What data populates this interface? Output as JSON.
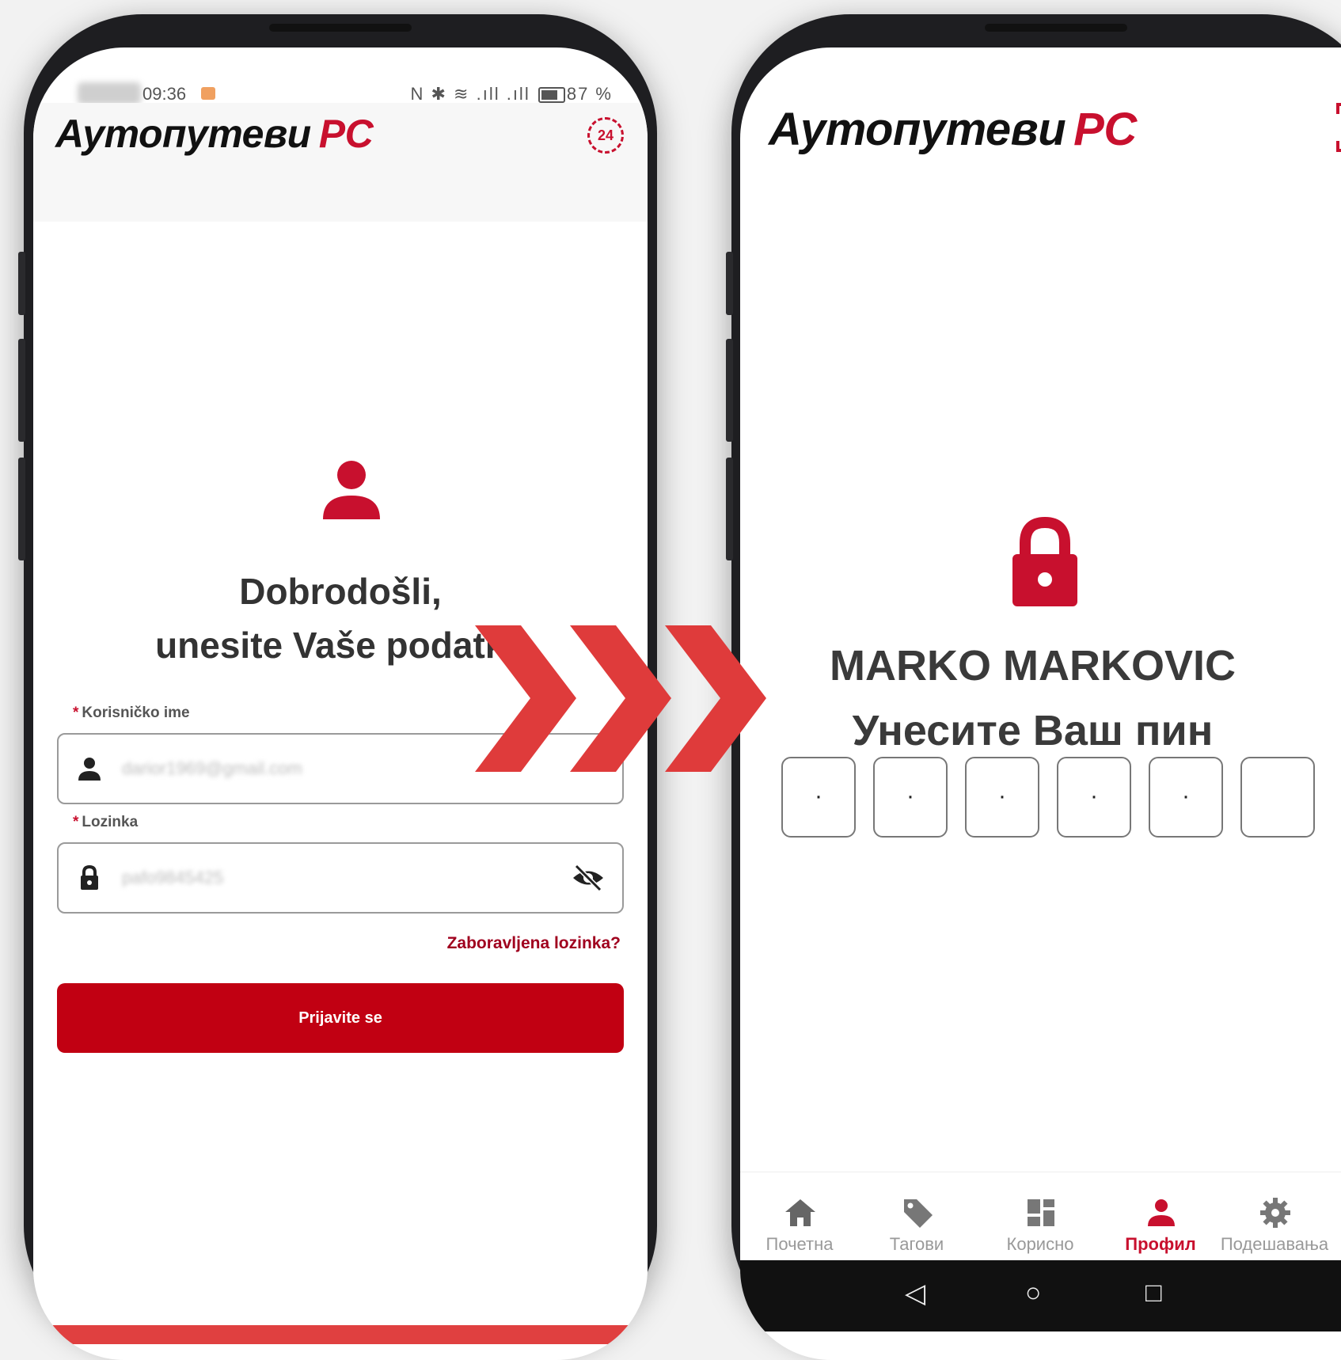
{
  "left_screen": {
    "status": {
      "time": "09:36",
      "battery": "87 %",
      "icons": "N ✱ ≋ .ıll .ıll"
    },
    "app_title": "Аутопутеви",
    "app_title_suffix": "РС",
    "badge_24": "24",
    "welcome_line1": "Dobrodošli,",
    "welcome_line2": "unesite Vaše podatke",
    "username": {
      "label": "Korisničko ime",
      "required_mark": "*",
      "value": "darior1969@gmail.com"
    },
    "password": {
      "label": "Lozinka",
      "required_mark": "*",
      "value": "pafo9845425"
    },
    "forgot_password": "Zaboravljena lozinka?",
    "login_button": "Prijavite se"
  },
  "right_screen": {
    "app_title": "Аутопутеви",
    "app_title_suffix": "РС",
    "user_name": "MARKO MARKOVIC",
    "pin_prompt": "Унесите Ваш пин",
    "pin_digits": [
      "·",
      "·",
      "·",
      "·",
      "·",
      ""
    ],
    "bottom_nav": [
      {
        "label": "Почетна",
        "icon": "home-icon",
        "active": false
      },
      {
        "label": "Тагови",
        "icon": "tag-icon",
        "active": false
      },
      {
        "label": "Корисно",
        "icon": "dashboard-icon",
        "active": false
      },
      {
        "label": "Профил",
        "icon": "profile-icon",
        "active": true
      },
      {
        "label": "Подешавања",
        "icon": "settings-icon",
        "active": false
      }
    ],
    "system_nav": {
      "back": "◁",
      "home": "○",
      "recents": "□"
    }
  },
  "colors": {
    "brand_red": "#c8102e",
    "button_red": "#c10012",
    "arrow_red": "#df3b3b"
  }
}
